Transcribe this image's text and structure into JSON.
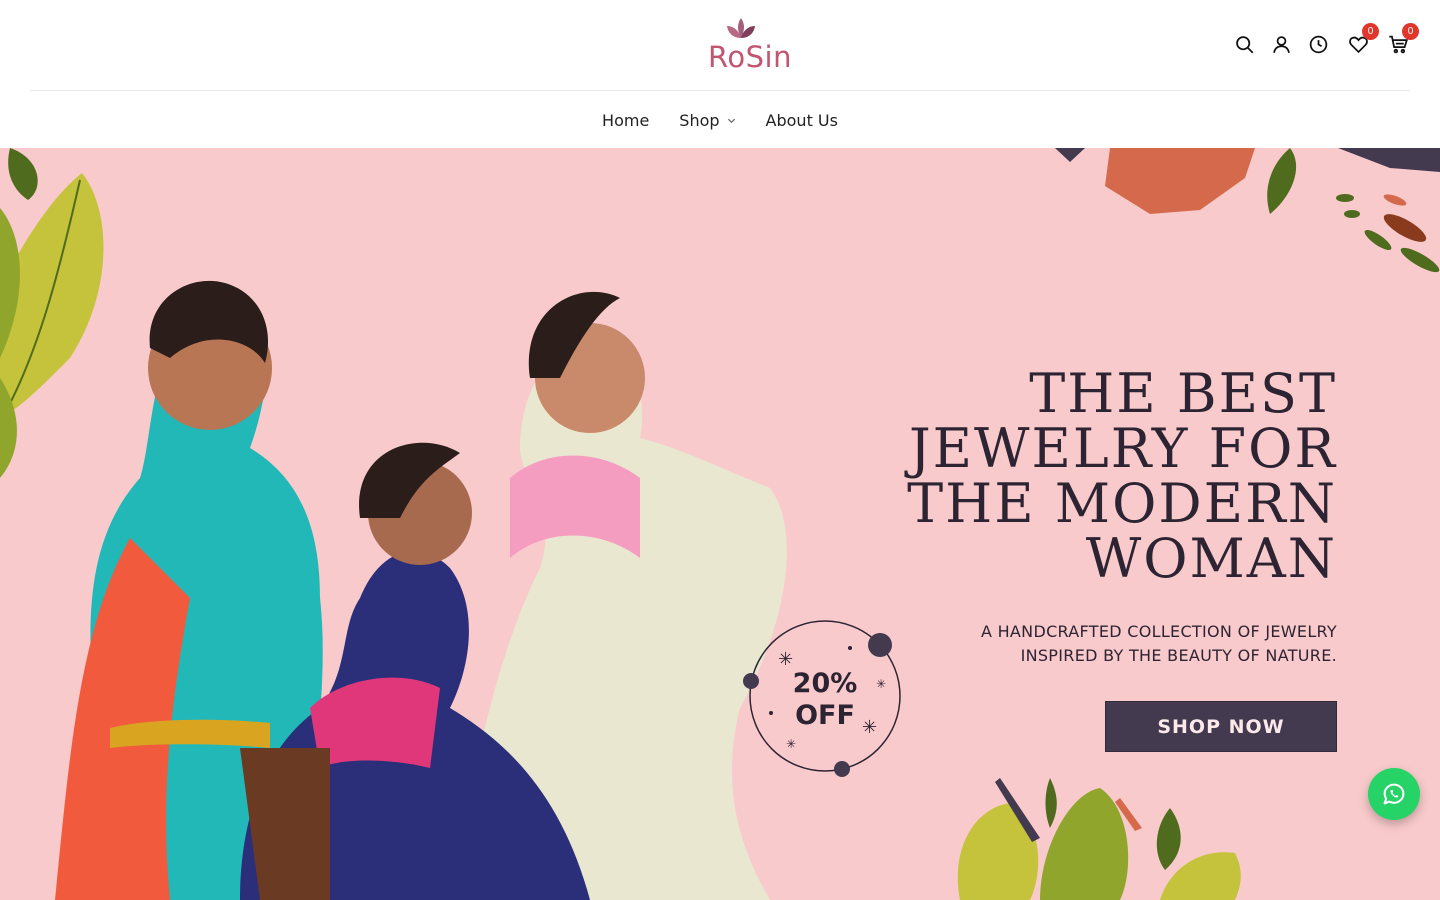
{
  "brand": {
    "name": "RoSin",
    "color": "#c25570",
    "mark_color": "#a3607a"
  },
  "header": {
    "icons": [
      {
        "name": "search-icon"
      },
      {
        "name": "account-icon"
      },
      {
        "name": "recently-viewed-icon"
      },
      {
        "name": "wishlist-icon",
        "count": "0"
      },
      {
        "name": "cart-icon",
        "count": "0"
      }
    ]
  },
  "nav": {
    "items": [
      {
        "label": "Home"
      },
      {
        "label": "Shop",
        "has_dropdown": true
      },
      {
        "label": "About Us"
      }
    ]
  },
  "hero": {
    "background": "#f9cacb",
    "headline_lines": [
      "THE BEST",
      "JEWELRY FOR",
      "THE MODERN",
      "WOMAN"
    ],
    "subtitle_lines": [
      "A HANDCRAFTED COLLECTION OF JEWELRY",
      "INSPIRED BY THE BEAUTY OF NATURE."
    ],
    "cta_label": "SHOP NOW",
    "offer": {
      "line1": "20%",
      "line2": "OFF"
    },
    "accent_dark": "#433a4f",
    "leaf_green": "#c5c23b",
    "leaf_dark_green": "#4f6b1e",
    "terracotta": "#d4694b"
  },
  "whatsapp": {
    "icon": "whatsapp-icon",
    "color": "#25d366"
  }
}
